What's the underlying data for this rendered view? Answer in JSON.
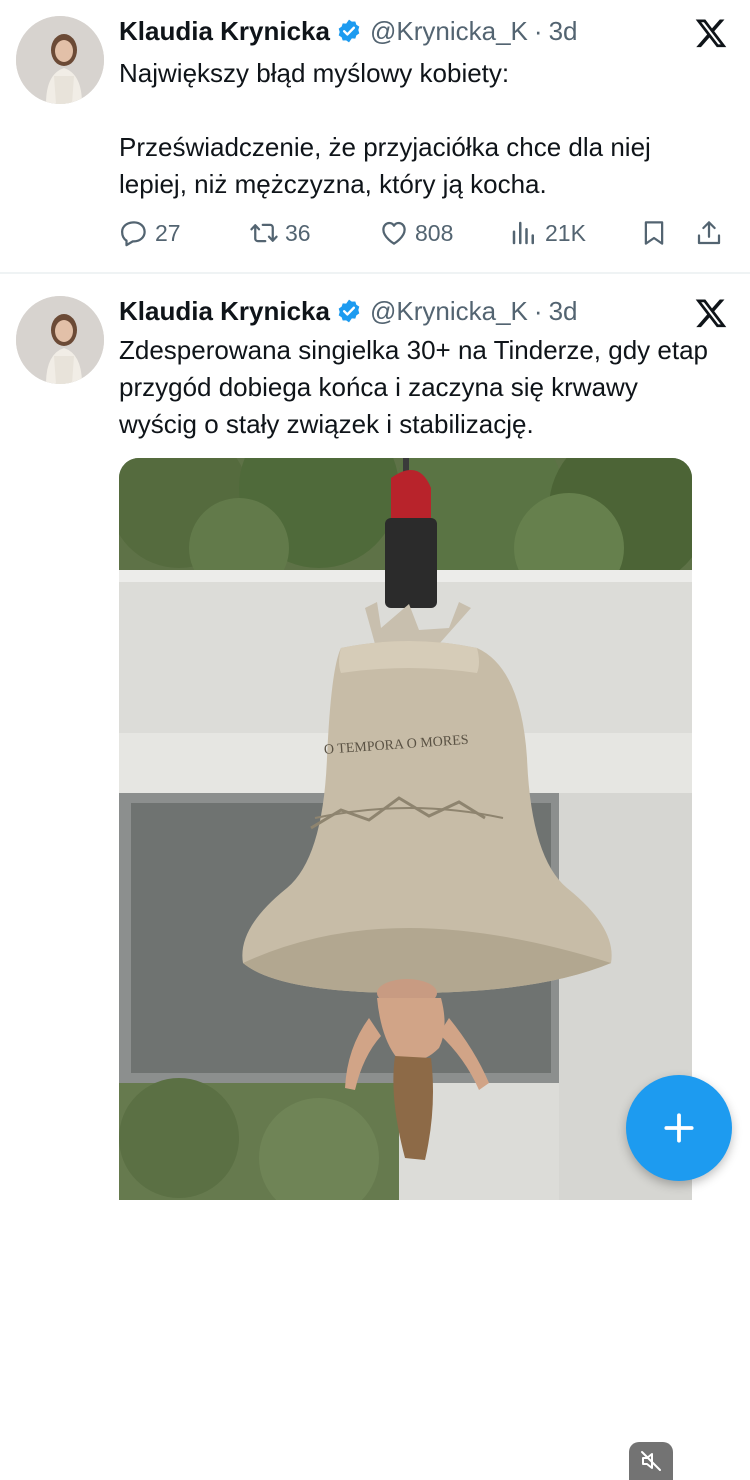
{
  "tweets": [
    {
      "author_name": "Klaudia Krynicka",
      "handle": "@Krynicka_K",
      "separator": "·",
      "time": "3d",
      "text_lines": [
        "Największy błąd myślowy kobiety:",
        "Przeświadczenie, że przyjaciółka chce dla niej lepiej, niż mężczyzna, który ją kocha."
      ],
      "stats": {
        "replies": "27",
        "reposts": "36",
        "likes": "808",
        "views": "21K"
      }
    },
    {
      "author_name": "Klaudia Krynicka",
      "handle": "@Krynicka_K",
      "separator": "·",
      "time": "3d",
      "text": "Zdesperowana singielka 30+ na Tinderze, gdy etap przygód dobiega końca i zaczyna się krwawy wyścig o stały związek i stabilizację.",
      "media": {
        "bell_inscription": "O TEMPORA O MORES"
      }
    }
  ],
  "icons": {
    "verified": "verified-badge-icon",
    "x_logo": "x-logo-icon",
    "reply": "reply-icon",
    "repost": "repost-icon",
    "like": "heart-icon",
    "views": "views-icon",
    "bookmark": "bookmark-icon",
    "share": "share-icon",
    "compose": "plus-icon",
    "mute": "mute-icon"
  },
  "colors": {
    "accent": "#1d9bf0",
    "text_primary": "#0f1419",
    "text_secondary": "#536471",
    "divider": "#eff3f4"
  }
}
